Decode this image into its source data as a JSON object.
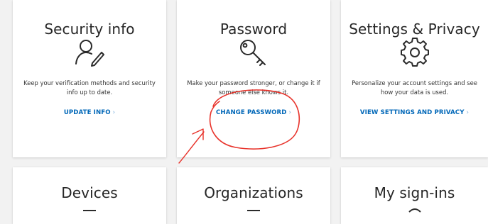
{
  "colors": {
    "page_bg": "#f2f2f2",
    "card_bg": "#ffffff",
    "link": "#0067b8",
    "annotation": "#e8332b"
  },
  "cards": [
    {
      "title": "Security info",
      "icon": "user-edit-icon",
      "description": "Keep your verification methods and security info up to date.",
      "link": "UPDATE INFO"
    },
    {
      "title": "Password",
      "icon": "key-icon",
      "description": "Make your password stronger, or change it if someone else knows it.",
      "link": "CHANGE PASSWORD"
    },
    {
      "title": "Settings & Privacy",
      "icon": "gear-icon",
      "description": "Personalize your account settings and see how your data is used.",
      "link": "VIEW SETTINGS AND PRIVACY"
    },
    {
      "title": "Devices",
      "icon": "devices-icon"
    },
    {
      "title": "Organizations",
      "icon": "organization-icon"
    },
    {
      "title": "My sign-ins",
      "icon": "sign-ins-icon"
    }
  ],
  "link_chevron": "›",
  "annotation": {
    "circle": "hand-drawn-circle",
    "arrow": "hand-drawn-arrow"
  }
}
